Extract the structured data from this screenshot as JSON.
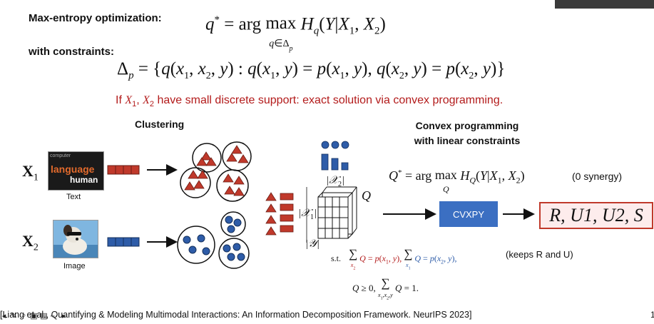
{
  "header": {
    "maxent_label": "Max-entropy optimization:",
    "constraints_label": "with constraints:",
    "objective_formula": "q* = arg max_{q ∈ Δp} H_q(Y | X1, X2)",
    "constraint_formula": "Δp = {q(x1, x2, y) : q(x1, y) = p(x1, y), q(x2, y) = p(x2, y)}"
  },
  "highlight": {
    "text": "If X1, X2 have small discrete support: exact solution via convex programming.",
    "color": "#b31b1b"
  },
  "sections": {
    "clustering": "Clustering",
    "convex_line1": "Convex programming",
    "convex_line2": "with linear constraints"
  },
  "modalities": [
    {
      "symbol": "X1",
      "caption": "Text",
      "thumb_words": [
        "language",
        "human",
        "computer"
      ],
      "token_color": "#c0392b"
    },
    {
      "symbol": "X2",
      "caption": "Image",
      "token_color": "#2e5ca8"
    }
  ],
  "table_labels": {
    "x2": "|X2|",
    "x1": "|X1|",
    "y": "|Y|",
    "q": "Q"
  },
  "solver": {
    "q_star_formula": "Q* = arg max_Q H_Q(Y | X1, X2)",
    "zero_synergy": "(0 synergy)",
    "cvxpy_label": "CVXPY",
    "result": "R, U1, U2, S",
    "st_label": "s.t.",
    "constraint_marginals": "Σx2 Q = p(x1, y),  Σx1 Q = p(x2, y),",
    "keeps_note": "(keeps R and U)",
    "constraint_simplex": "Q ≥ 0,  Σx1,x2,y Q = 1."
  },
  "citation": "[Liang et al., Quantifying & Modeling Multimodal Interactions: An Information Decomposition Framework. NeurIPS 2023]",
  "colors": {
    "red_item": "#c0392b",
    "blue_item": "#2e5ca8",
    "cvxpy_fill": "#3b6fc2",
    "result_border": "#c0392b",
    "result_fill": "#fdecec"
  },
  "toolbar_icons": [
    "back-icon",
    "pen-icon",
    "zoom-icon",
    "screen-icon",
    "slides-icon",
    "more-icon",
    "next-icon"
  ]
}
